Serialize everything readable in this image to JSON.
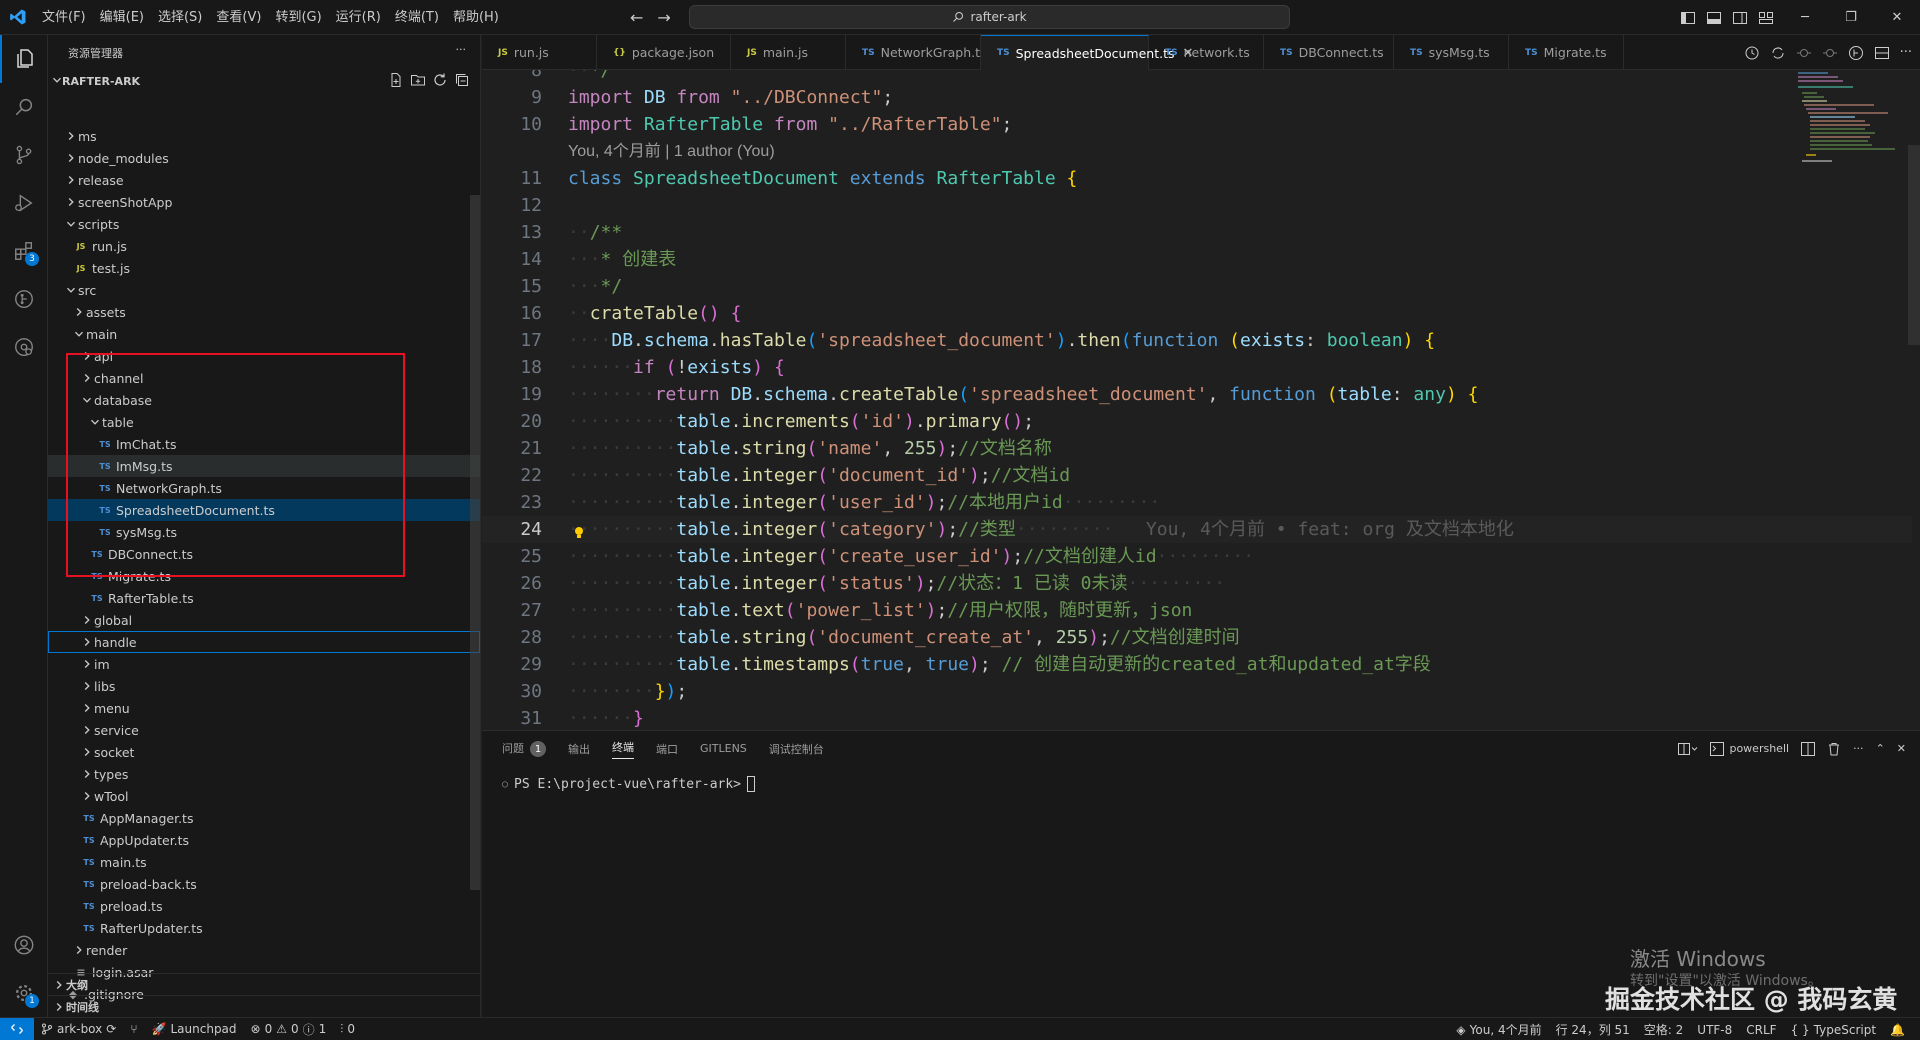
{
  "titlebar": {
    "menu": [
      "文件(F)",
      "编辑(E)",
      "选择(S)",
      "查看(V)",
      "转到(G)",
      "运行(R)",
      "终端(T)",
      "帮助(H)"
    ],
    "search": "rafter-ark"
  },
  "activity": {
    "extensions_badge": "3",
    "settings_badge": "1"
  },
  "sidebar": {
    "header": "资源管理器",
    "root": "RAFTER-ARK",
    "tree": [
      {
        "label": "ms",
        "type": "folder",
        "open": false,
        "depth": 1
      },
      {
        "label": "node_modules",
        "type": "folder",
        "open": false,
        "depth": 1
      },
      {
        "label": "release",
        "type": "folder",
        "open": false,
        "depth": 1
      },
      {
        "label": "screenShotApp",
        "type": "folder",
        "open": false,
        "depth": 1
      },
      {
        "label": "scripts",
        "type": "folder",
        "open": true,
        "depth": 1
      },
      {
        "label": "run.js",
        "type": "js",
        "depth": 2
      },
      {
        "label": "test.js",
        "type": "js",
        "depth": 2
      },
      {
        "label": "src",
        "type": "folder",
        "open": true,
        "depth": 1
      },
      {
        "label": "assets",
        "type": "folder",
        "open": false,
        "depth": 2
      },
      {
        "label": "main",
        "type": "folder",
        "open": true,
        "depth": 2
      },
      {
        "label": "api",
        "type": "folder",
        "open": false,
        "depth": 3
      },
      {
        "label": "channel",
        "type": "folder",
        "open": false,
        "depth": 3
      },
      {
        "label": "database",
        "type": "folder",
        "open": true,
        "depth": 3
      },
      {
        "label": "table",
        "type": "folder",
        "open": true,
        "depth": 4
      },
      {
        "label": "ImChat.ts",
        "type": "ts",
        "depth": 5
      },
      {
        "label": "ImMsg.ts",
        "type": "ts",
        "depth": 5,
        "hover": true
      },
      {
        "label": "NetworkGraph.ts",
        "type": "ts",
        "depth": 5
      },
      {
        "label": "SpreadsheetDocument.ts",
        "type": "ts",
        "depth": 5,
        "selected": true
      },
      {
        "label": "sysMsg.ts",
        "type": "ts",
        "depth": 5
      },
      {
        "label": "DBConnect.ts",
        "type": "ts",
        "depth": 4
      },
      {
        "label": "Migrate.ts",
        "type": "ts",
        "depth": 4
      },
      {
        "label": "RafterTable.ts",
        "type": "ts",
        "depth": 4
      },
      {
        "label": "global",
        "type": "folder",
        "open": false,
        "depth": 3
      },
      {
        "label": "handle",
        "type": "folder",
        "open": false,
        "depth": 3,
        "focused": true
      },
      {
        "label": "im",
        "type": "folder",
        "open": false,
        "depth": 3
      },
      {
        "label": "libs",
        "type": "folder",
        "open": false,
        "depth": 3
      },
      {
        "label": "menu",
        "type": "folder",
        "open": false,
        "depth": 3
      },
      {
        "label": "service",
        "type": "folder",
        "open": false,
        "depth": 3
      },
      {
        "label": "socket",
        "type": "folder",
        "open": false,
        "depth": 3
      },
      {
        "label": "types",
        "type": "folder",
        "open": false,
        "depth": 3
      },
      {
        "label": "wTool",
        "type": "folder",
        "open": false,
        "depth": 3
      },
      {
        "label": "AppManager.ts",
        "type": "ts",
        "depth": 3
      },
      {
        "label": "AppUpdater.ts",
        "type": "ts",
        "depth": 3
      },
      {
        "label": "main.ts",
        "type": "ts",
        "depth": 3
      },
      {
        "label": "preload-back.ts",
        "type": "ts",
        "depth": 3
      },
      {
        "label": "preload.ts",
        "type": "ts",
        "depth": 3
      },
      {
        "label": "RafterUpdater.ts",
        "type": "ts",
        "depth": 3
      },
      {
        "label": "render",
        "type": "folder",
        "open": false,
        "depth": 2
      },
      {
        "label": "login.asar",
        "type": "file",
        "depth": 2
      },
      {
        "label": ".gitignore",
        "type": "git",
        "depth": 1
      }
    ],
    "sections": [
      "大纲",
      "时间线"
    ]
  },
  "tabs": [
    {
      "label": "run.js",
      "type": "js"
    },
    {
      "label": "package.json",
      "type": "json"
    },
    {
      "label": "main.js",
      "type": "js"
    },
    {
      "label": "NetworkGraph.ts",
      "type": "ts"
    },
    {
      "label": "SpreadsheetDocument.ts",
      "type": "ts",
      "active": true
    },
    {
      "label": "network.ts",
      "type": "ts"
    },
    {
      "label": "DBConnect.ts",
      "type": "ts"
    },
    {
      "label": "sysMsg.ts",
      "type": "ts"
    },
    {
      "label": "Migrate.ts",
      "type": "ts"
    }
  ],
  "editor": {
    "codelens": "You, 4个月前 | 1 author (You)",
    "current_line": "24",
    "lines": [
      {
        "n": "8",
        "html": "<span class='ws'>··</span><span class='c'>*/</span>"
      },
      {
        "n": "9",
        "html": "<span class='kc'>import</span> <span class='v'>DB</span> <span class='kc'>from</span> <span class='s'>\"../DBConnect\"</span><span class='p'>;</span>"
      },
      {
        "n": "10",
        "html": "<span class='kc'>import</span> <span class='t'>RafterTable</span> <span class='kc'>from</span> <span class='s'>\"../RafterTable\"</span><span class='p'>;</span>"
      },
      {
        "n": "",
        "lens": true
      },
      {
        "n": "11",
        "html": "<span class='k'>class</span> <span class='t'>SpreadsheetDocument</span> <span class='k'>extends</span> <span class='t'>RafterTable</span> <span class='b1'>{</span>"
      },
      {
        "n": "12",
        "html": ""
      },
      {
        "n": "13",
        "html": "<span class='ws'>··</span><span class='c'>/**</span>"
      },
      {
        "n": "14",
        "html": "<span class='ws'>···</span><span class='c'>* 创建表</span>"
      },
      {
        "n": "15",
        "html": "<span class='ws'>···</span><span class='c'>*/</span>"
      },
      {
        "n": "16",
        "html": "<span class='ws'>··</span><span class='f'>crateTable</span><span class='b2'>()</span> <span class='b2'>{</span>"
      },
      {
        "n": "17",
        "html": "<span class='ws'>····</span><span class='v'>DB</span><span class='p'>.</span><span class='v'>schema</span><span class='p'>.</span><span class='f'>hasTable</span><span class='b3'>(</span><span class='s'>'spreadsheet_document'</span><span class='b3'>)</span><span class='p'>.</span><span class='f'>then</span><span class='b3'>(</span><span class='k'>function</span> <span class='b1'>(</span><span class='v'>exists</span><span class='p'>:</span> <span class='t'>boolean</span><span class='b1'>)</span> <span class='b1'>{</span>"
      },
      {
        "n": "18",
        "html": "<span class='ws'>······</span><span class='kc'>if</span> <span class='b2'>(</span><span class='p'>!</span><span class='v'>exists</span><span class='b2'>)</span> <span class='b2'>{</span>"
      },
      {
        "n": "19",
        "html": "<span class='ws'>········</span><span class='kc'>return</span> <span class='v'>DB</span><span class='p'>.</span><span class='v'>schema</span><span class='p'>.</span><span class='f'>createTable</span><span class='b3'>(</span><span class='s'>'spreadsheet_document'</span><span class='p'>,</span> <span class='k'>function</span> <span class='b1'>(</span><span class='v'>table</span><span class='p'>:</span> <span class='t'>any</span><span class='b1'>)</span> <span class='b1'>{</span>"
      },
      {
        "n": "20",
        "html": "<span class='ws'>··········</span><span class='v'>table</span><span class='p'>.</span><span class='f'>increments</span><span class='b2'>(</span><span class='s'>'id'</span><span class='b2'>)</span><span class='p'>.</span><span class='f'>primary</span><span class='b2'>()</span><span class='p'>;</span>"
      },
      {
        "n": "21",
        "html": "<span class='ws'>··········</span><span class='v'>table</span><span class='p'>.</span><span class='f'>string</span><span class='b2'>(</span><span class='s'>'name'</span><span class='p'>,</span> <span class='n'>255</span><span class='b2'>)</span><span class='p'>;</span><span class='c'>//文档名称</span>"
      },
      {
        "n": "22",
        "html": "<span class='ws'>··········</span><span class='v'>table</span><span class='p'>.</span><span class='f'>integer</span><span class='b2'>(</span><span class='s'>'document_id'</span><span class='b2'>)</span><span class='p'>;</span><span class='c'>//文档id</span>"
      },
      {
        "n": "23",
        "html": "<span class='ws'>··········</span><span class='v'>table</span><span class='p'>.</span><span class='f'>integer</span><span class='b2'>(</span><span class='s'>'user_id'</span><span class='b2'>)</span><span class='p'>;</span><span class='c'>//本地用户id</span><span class='ws'>·········</span>"
      },
      {
        "n": "24",
        "current": true,
        "html": "<span class='ws'>··········</span><span class='v'>table</span><span class='p'>.</span><span class='f'>integer</span><span class='b2'>(</span><span class='s'>'category'</span><span class='b2'>)</span><span class='p'>;</span><span class='c'>//类型</span><span class='ws'>·········</span>   <span class='blame'>You, 4个月前 • feat: org 及文档本地化</span>"
      },
      {
        "n": "25",
        "html": "<span class='ws'>··········</span><span class='v'>table</span><span class='p'>.</span><span class='f'>integer</span><span class='b2'>(</span><span class='s'>'create_user_id'</span><span class='b2'>)</span><span class='p'>;</span><span class='c'>//文档创建人id</span><span class='ws'>·········</span>"
      },
      {
        "n": "26",
        "html": "<span class='ws'>··········</span><span class='v'>table</span><span class='p'>.</span><span class='f'>integer</span><span class='b2'>(</span><span class='s'>'status'</span><span class='b2'>)</span><span class='p'>;</span><span class='c'>//状态：1 已读 0未读</span><span class='ws'>·········</span>"
      },
      {
        "n": "27",
        "html": "<span class='ws'>··········</span><span class='v'>table</span><span class='p'>.</span><span class='f'>text</span><span class='b2'>(</span><span class='s'>'power_list'</span><span class='b2'>)</span><span class='p'>;</span><span class='c'>//用户权限，随时更新，json</span>"
      },
      {
        "n": "28",
        "html": "<span class='ws'>··········</span><span class='v'>table</span><span class='p'>.</span><span class='f'>string</span><span class='b2'>(</span><span class='s'>'document_create_at'</span><span class='p'>,</span> <span class='n'>255</span><span class='b2'>)</span><span class='p'>;</span><span class='c'>//文档创建时间</span>"
      },
      {
        "n": "29",
        "html": "<span class='ws'>··········</span><span class='v'>table</span><span class='p'>.</span><span class='f'>timestamps</span><span class='b2'>(</span><span class='k'>true</span><span class='p'>,</span> <span class='k'>true</span><span class='b2'>)</span><span class='p'>;</span> <span class='c'>// 创建自动更新的created_at和updated_at字段</span>"
      },
      {
        "n": "30",
        "html": "<span class='ws'>········</span><span class='b1'>}</span><span class='b3'>)</span><span class='p'>;</span>"
      },
      {
        "n": "31",
        "html": "<span class='ws'>······</span><span class='b2'>}</span>"
      }
    ]
  },
  "panel": {
    "tabs": [
      "问题",
      "输出",
      "终端",
      "端口",
      "GITLENS",
      "调试控制台"
    ],
    "active_tab": "终端",
    "problems_count": "1",
    "shell": "powershell",
    "prompt": "PS E:\\project-vue\\rafter-ark>"
  },
  "overlay": {
    "activate_title": "激活 Windows",
    "activate_sub": "转到\"设置\"以激活 Windows。",
    "watermark": "掘金技术社区 @ 我码玄黄"
  },
  "statusbar": {
    "branch": "ark-box",
    "launchpad": "Launchpad",
    "problems": "0",
    "warnings": "0",
    "info": "1",
    "ports": "0",
    "blame": "You, 4个月前",
    "position": "行 24，列 51",
    "spaces": "空格: 2",
    "encoding": "UTF-8",
    "eol": "CRLF",
    "language": "TypeScript"
  },
  "colors": {
    "accent": "#0078d4",
    "highlight_box": "#e81123",
    "selected_row": "#04395e"
  }
}
